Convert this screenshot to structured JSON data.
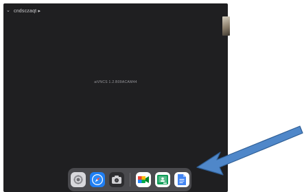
{
  "topbar": {
    "chevron": "⌄",
    "label": "cndsczaqt ▸"
  },
  "center": {
    "text": "aiVNCS 1.2.B09ACAM44"
  },
  "dock": {
    "apps": [
      {
        "name": "Settings",
        "icon": "gear-icon"
      },
      {
        "name": "Safari",
        "icon": "compass-icon"
      },
      {
        "name": "Camera",
        "icon": "camera-icon"
      },
      {
        "name": "Google Meet",
        "icon": "video-icon"
      },
      {
        "name": "Google Classroom",
        "icon": "classroom-icon"
      },
      {
        "name": "Google Docs",
        "icon": "document-icon"
      }
    ]
  },
  "colors": {
    "screen_bg": "#1f1f21",
    "dock_bg": "#4a4a4e",
    "arrow": "#4f87c9"
  }
}
